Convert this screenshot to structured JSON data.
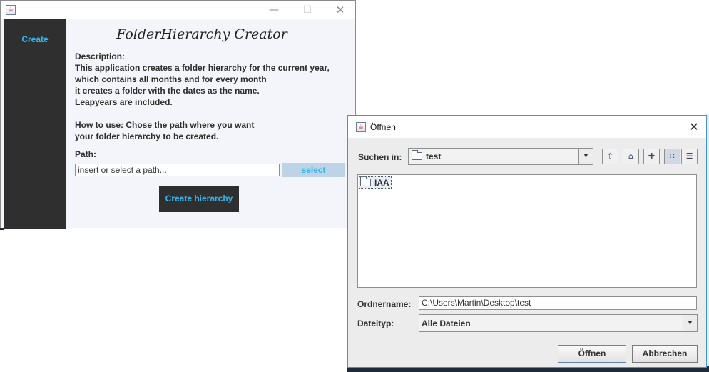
{
  "main_window": {
    "sidebar": {
      "create_label": "Create"
    },
    "app_title": "FolderHierarchy Creator",
    "description": [
      "Description:",
      "This application creates a folder hierarchy for the current year,",
      "which contains all months and for every month",
      "it creates a folder with the dates as the name.",
      "Leapyears are included."
    ],
    "how_to_use": [
      "How to use: Chose the path where you want",
      "your folder hierarchy to be created."
    ],
    "path_label": "Path:",
    "path_input": {
      "value": "insert or select a path..."
    },
    "select_button": "select",
    "create_button": "Create hierarchy"
  },
  "open_dialog": {
    "title": "Öffnen",
    "look_in_label": "Suchen in:",
    "look_in_value": "test",
    "files": [
      "IAA"
    ],
    "folder_name_label": "Ordnername:",
    "folder_name_value": "C:\\Users\\Martin\\Desktop\\test",
    "file_type_label": "Dateityp:",
    "file_type_value": "Alle Dateien",
    "open_button": "Öffnen",
    "cancel_button": "Abbrechen"
  },
  "colors": {
    "sidebar": "#2f2f2f",
    "accent": "#2fb8f0",
    "select_button_bg": "#bfd3e6",
    "dialog_bg": "#ececec"
  }
}
